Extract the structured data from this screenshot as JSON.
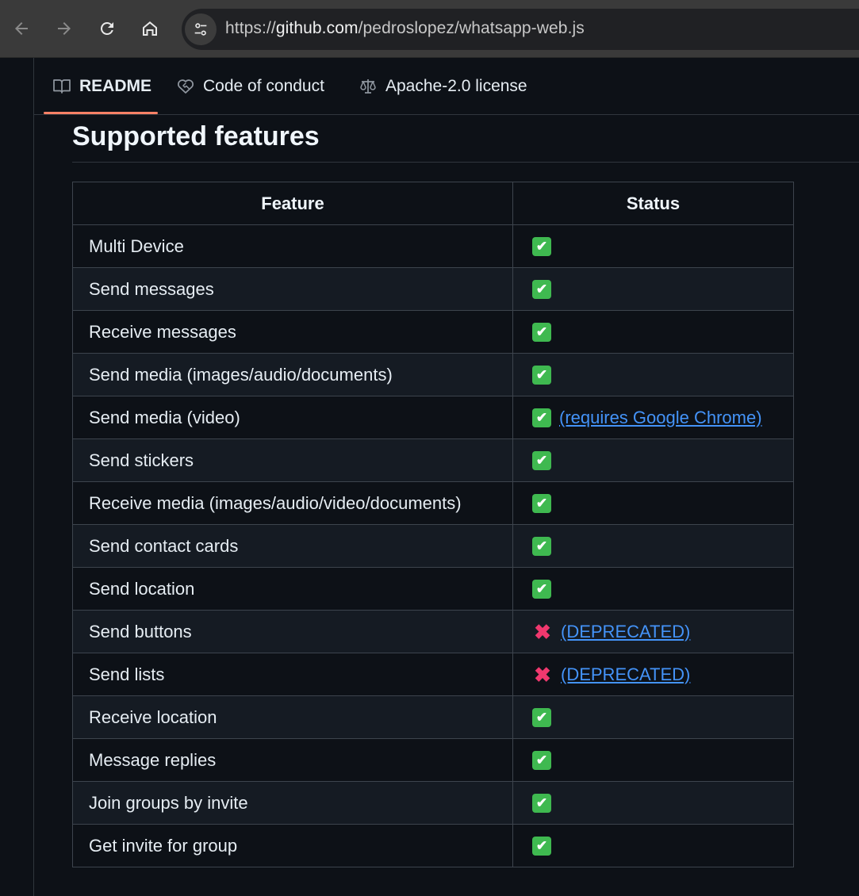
{
  "browser": {
    "url_prefix": "https://",
    "url_host": "github.com",
    "url_path": "/pedroslopez/whatsapp-web.js"
  },
  "tabs": [
    {
      "label": "README",
      "icon": "book-icon",
      "active": true
    },
    {
      "label": "Code of conduct",
      "icon": "heart-handshake-icon",
      "active": false
    },
    {
      "label": "Apache-2.0 license",
      "icon": "law-scale-icon",
      "active": false
    }
  ],
  "section": {
    "title": "Supported features"
  },
  "table": {
    "headers": {
      "feature": "Feature",
      "status": "Status"
    },
    "rows": [
      {
        "feature": "Multi Device",
        "status": "check",
        "note": ""
      },
      {
        "feature": "Send messages",
        "status": "check",
        "note": ""
      },
      {
        "feature": "Receive messages",
        "status": "check",
        "note": ""
      },
      {
        "feature": "Send media (images/audio/documents)",
        "status": "check",
        "note": ""
      },
      {
        "feature": "Send media (video)",
        "status": "check",
        "note": "(requires Google Chrome)"
      },
      {
        "feature": "Send stickers",
        "status": "check",
        "note": ""
      },
      {
        "feature": "Receive media (images/audio/video/documents)",
        "status": "check",
        "note": ""
      },
      {
        "feature": "Send contact cards",
        "status": "check",
        "note": ""
      },
      {
        "feature": "Send location",
        "status": "check",
        "note": ""
      },
      {
        "feature": "Send buttons",
        "status": "cross",
        "note": "(DEPRECATED)"
      },
      {
        "feature": "Send lists",
        "status": "cross",
        "note": "(DEPRECATED)"
      },
      {
        "feature": "Receive location",
        "status": "check",
        "note": ""
      },
      {
        "feature": "Message replies",
        "status": "check",
        "note": ""
      },
      {
        "feature": "Join groups by invite",
        "status": "check",
        "note": ""
      },
      {
        "feature": "Get invite for group",
        "status": "check",
        "note": ""
      }
    ]
  },
  "colors": {
    "check": "#3fb950",
    "cross": "#f0386e",
    "link": "#4493f8",
    "tab_underline": "#f78166"
  }
}
